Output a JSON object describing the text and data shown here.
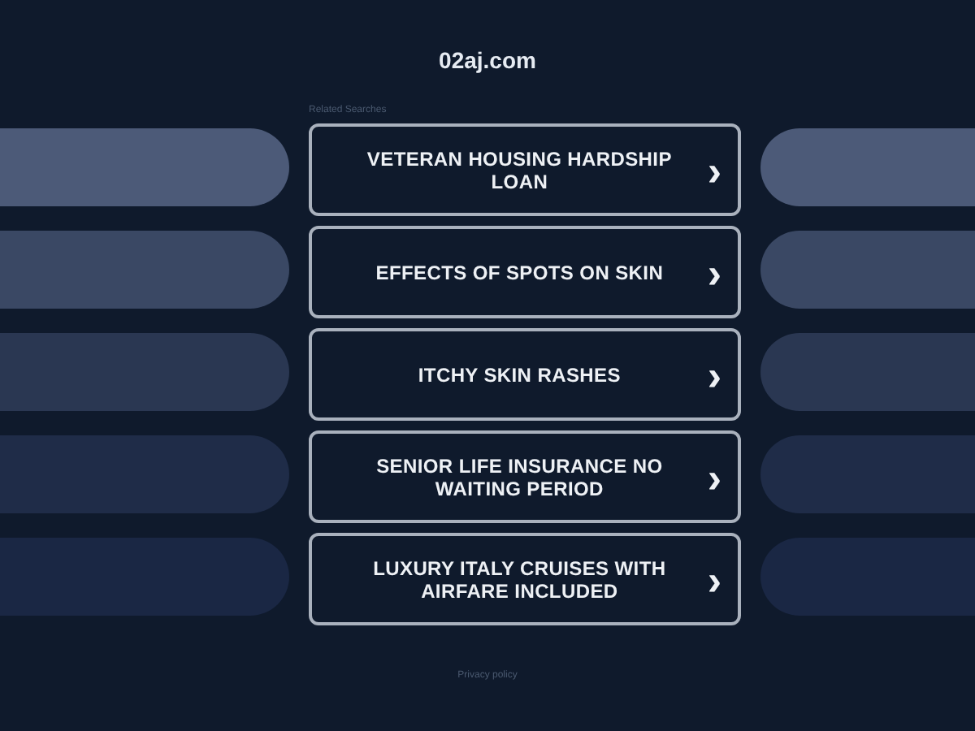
{
  "site": {
    "domain": "02aj.com"
  },
  "related": {
    "heading": "Related Searches",
    "links": [
      {
        "label": "VETERAN HOUSING HARDSHIP LOAN",
        "arrow": "›"
      },
      {
        "label": "EFFECTS OF SPOTS ON SKIN",
        "arrow": "›"
      },
      {
        "label": "ITCHY SKIN RASHES",
        "arrow": "›"
      },
      {
        "label": "SENIOR LIFE INSURANCE NO WAITING PERIOD",
        "arrow": "›"
      },
      {
        "label": "LUXURY ITALY CRUISES WITH AIRFARE INCLUDED",
        "arrow": "›"
      }
    ]
  },
  "footer": {
    "link": "Privacy policy"
  }
}
